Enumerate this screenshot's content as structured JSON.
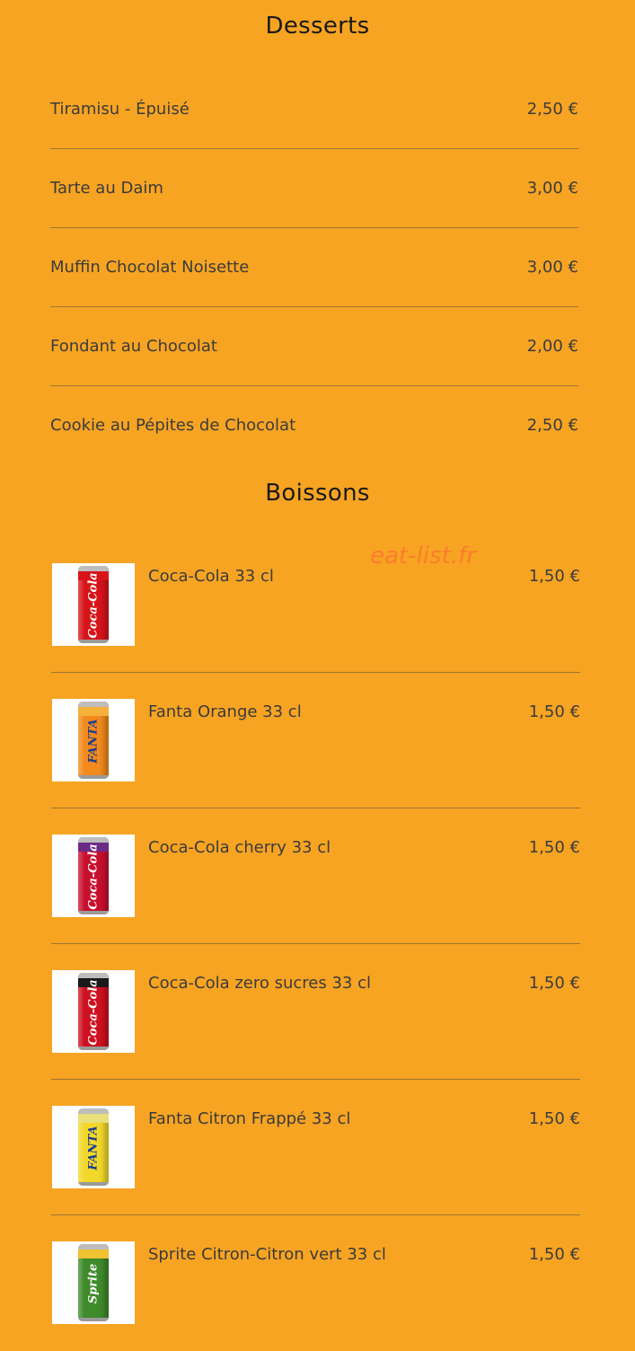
{
  "sections": {
    "desserts_title": "Desserts",
    "boissons_title": "Boissons"
  },
  "watermark": "eat-list.fr",
  "desserts": [
    {
      "name": "Tiramisu - Épuisé",
      "price": "2,50 €"
    },
    {
      "name": "Tarte au Daim",
      "price": "3,00 €"
    },
    {
      "name": "Muffin Chocolat Noisette",
      "price": "3,00 €"
    },
    {
      "name": "Fondant au Chocolat",
      "price": "2,00 €"
    },
    {
      "name": "Cookie au Pépites de Chocolat",
      "price": "2,50 €"
    }
  ],
  "drinks": [
    {
      "name": "Coca-Cola 33 cl",
      "price": "1,50 €",
      "icon": "coca-cola-can-icon",
      "can_color": "#d7141a",
      "band_color": "#d7141a",
      "logo": "Coca-Cola",
      "logo_color": "#ffffff"
    },
    {
      "name": "Fanta Orange 33 cl",
      "price": "1,50 €",
      "icon": "fanta-orange-can-icon",
      "can_color": "#f28a1c",
      "band_color": "#f5b13a",
      "logo": "FANTA",
      "logo_color": "#1b3c8f"
    },
    {
      "name": "Coca-Cola cherry 33 cl",
      "price": "1,50 €",
      "icon": "coca-cola-cherry-can-icon",
      "can_color": "#c8102e",
      "band_color": "#6b2b86",
      "logo": "Coca-Cola",
      "logo_color": "#ffffff"
    },
    {
      "name": "Coca-Cola zero sucres 33 cl",
      "price": "1,50 €",
      "icon": "coca-cola-zero-can-icon",
      "can_color": "#cf1020",
      "band_color": "#1a1a1a",
      "logo": "Coca-Cola",
      "logo_color": "#ffffff"
    },
    {
      "name": "Fanta Citron Frappé 33 cl",
      "price": "1,50 €",
      "icon": "fanta-citron-can-icon",
      "can_color": "#f2d82a",
      "band_color": "#e8e07a",
      "logo": "FANTA",
      "logo_color": "#1b3c8f"
    },
    {
      "name": "Sprite Citron-Citron vert 33 cl",
      "price": "1,50 €",
      "icon": "sprite-can-icon",
      "can_color": "#3f8a2b",
      "band_color": "#f1c232",
      "logo": "Sprite",
      "logo_color": "#ffffff"
    }
  ]
}
